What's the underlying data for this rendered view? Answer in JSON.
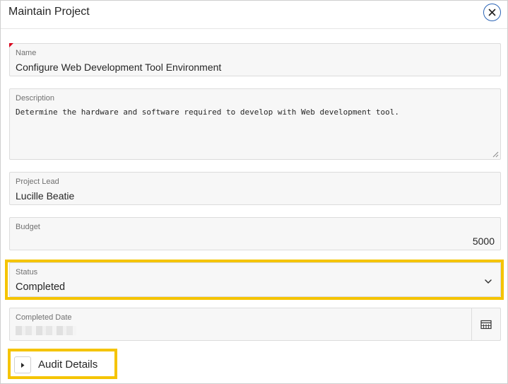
{
  "dialog": {
    "title": "Maintain Project",
    "close_icon": "close-icon"
  },
  "form": {
    "name": {
      "label": "Name",
      "value": "Configure Web Development Tool Environment",
      "required": true
    },
    "description": {
      "label": "Description",
      "value": "Determine the hardware and software required to develop with Web development tool."
    },
    "project_lead": {
      "label": "Project Lead",
      "value": "Lucille Beatie"
    },
    "budget": {
      "label": "Budget",
      "value": "5000"
    },
    "status": {
      "label": "Status",
      "value": "Completed",
      "icon": "chevron-down-icon"
    },
    "completed_date": {
      "label": "Completed Date",
      "icon": "calendar-icon"
    }
  },
  "audit": {
    "label": "Audit Details",
    "icon": "play-triangle-icon"
  },
  "colors": {
    "highlight": "#f5c400",
    "close_accent": "#2a63b5",
    "required": "#d8001c"
  }
}
